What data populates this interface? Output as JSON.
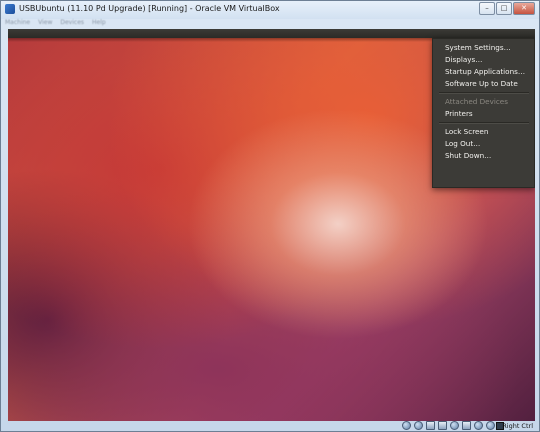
{
  "window": {
    "title": "USBUbuntu (11.10 Pd Upgrade) [Running] - Oracle VM VirtualBox",
    "controls": [
      "–",
      "□",
      "✕"
    ]
  },
  "menubar": {
    "items": [
      "Machine",
      "View",
      "Devices",
      "Help"
    ]
  },
  "session_menu": {
    "items": [
      {
        "label": "System Settings…",
        "enabled": true
      },
      {
        "label": "Displays…",
        "enabled": true
      },
      {
        "label": "Startup Applications…",
        "enabled": true
      },
      {
        "label": "Software Up to Date",
        "enabled": true
      },
      {
        "label": "Attached Devices",
        "enabled": false
      },
      {
        "label": "Printers",
        "enabled": true
      },
      {
        "label": "Lock Screen",
        "enabled": true
      },
      {
        "label": "Log Out…",
        "enabled": true
      },
      {
        "label": "Shut Down…",
        "enabled": true
      }
    ]
  },
  "statusbar": {
    "host_key": "Right Ctrl",
    "icons": [
      "hard-disk-icon",
      "optical-drive-icon",
      "usb-icon",
      "shared-folders-icon",
      "network-icon",
      "display-icon",
      "virtualization-icon",
      "mouse-integration-icon"
    ]
  },
  "colors": {
    "titlebar": "#dbe7f4",
    "ubuntu_panel": "#3c3b37",
    "wallpaper_orange": "#dd4814",
    "wallpaper_purple": "#772953"
  }
}
